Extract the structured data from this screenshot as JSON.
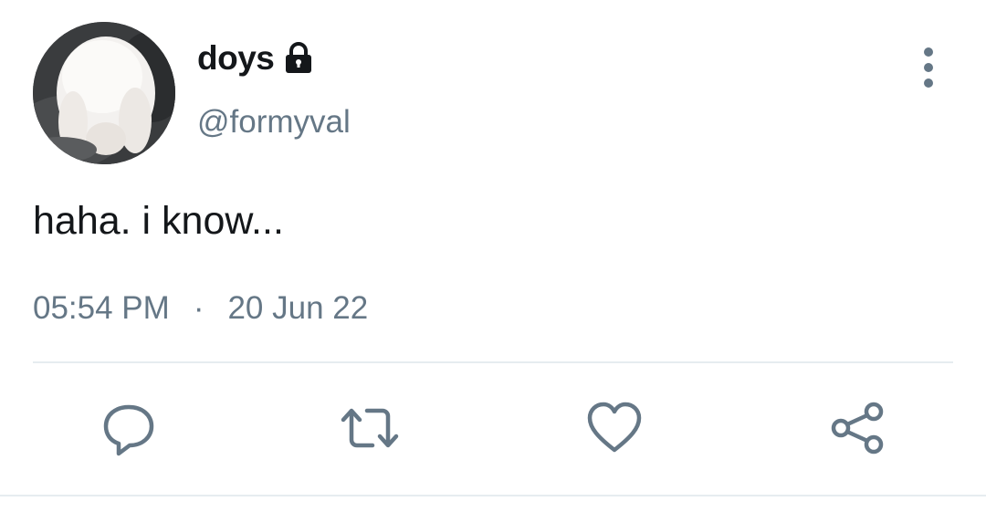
{
  "tweet": {
    "display_name": "doys",
    "handle": "@formyval",
    "text": "haha. i know...",
    "time": "05:54 PM",
    "separator": "·",
    "date": "20 Jun 22",
    "protected": true
  },
  "icons": {
    "lock": "lock-icon",
    "more": "more-vertical-icon",
    "reply": "reply-icon",
    "retweet": "retweet-icon",
    "like": "heart-icon",
    "share": "share-icon"
  },
  "colors": {
    "text_primary": "#14171a",
    "text_secondary": "#657786",
    "divider": "#e6ecf0"
  }
}
